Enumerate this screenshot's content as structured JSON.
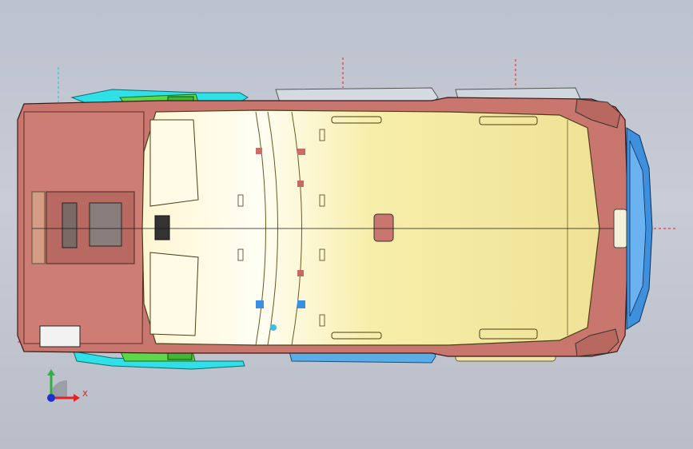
{
  "viewport": {
    "background_top": "#bcc2ce",
    "background_bottom": "#b9bec8"
  },
  "model": {
    "roof_color": "#f6eca6",
    "body_color": "#c9776e",
    "fender_color": "#c5d6e0",
    "bumper_color": "#3e8fdc",
    "mirror_color": "#2fe0e6",
    "bracket_color": "#5cd84a",
    "centerline_color": "#1a1a1a",
    "axis_mark_color": "#e02020"
  },
  "triad": {
    "x_label": "X",
    "x_color": "#e02424",
    "y_color": "#2fb040",
    "z_color": "#2030d0"
  }
}
